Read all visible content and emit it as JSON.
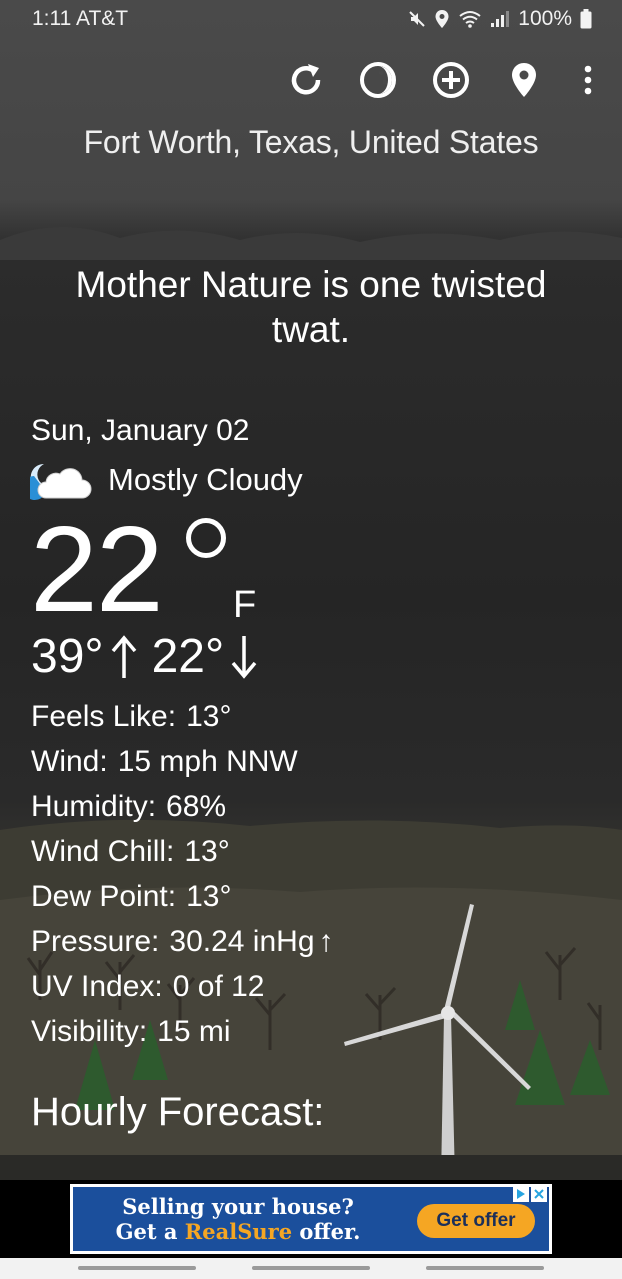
{
  "status_bar": {
    "time_carrier": "1:11 AT&T",
    "battery": "100%"
  },
  "toolbar": {
    "icons": [
      "refresh-icon",
      "theme-icon",
      "add-location-icon",
      "location-pin-icon",
      "overflow-menu-icon"
    ]
  },
  "location": "Fort Worth, Texas, United States",
  "quote": "Mother Nature is one twisted twat.",
  "current": {
    "date": "Sun, January 02",
    "condition": "Mostly Cloudy",
    "condition_icon": "partly-cloudy-night-icon",
    "temperature": "22",
    "unit": "F",
    "high": "39°",
    "low": "22°"
  },
  "details": [
    {
      "label": "Feels Like:",
      "value": "13°"
    },
    {
      "label": "Wind:",
      "value": "15 mph NNW"
    },
    {
      "label": "Humidity:",
      "value": "68%"
    },
    {
      "label": "Wind Chill:",
      "value": "13°"
    },
    {
      "label": "Dew Point:",
      "value": "13°"
    },
    {
      "label": "Pressure:",
      "value": "30.24 inHg",
      "trend": "↑"
    },
    {
      "label": "UV Index:",
      "value": "0 of 12"
    },
    {
      "label": "Visibility:",
      "value": "15 mi"
    }
  ],
  "hourly_heading": "Hourly Forecast:",
  "ad": {
    "line1": "Selling your house?",
    "line2_prefix": "Get a ",
    "brand": "RealSure",
    "line2_suffix": " offer.",
    "cta": "Get offer"
  },
  "colors": {
    "ad_background": "#1b4f9c",
    "ad_accent": "#f5a623"
  }
}
